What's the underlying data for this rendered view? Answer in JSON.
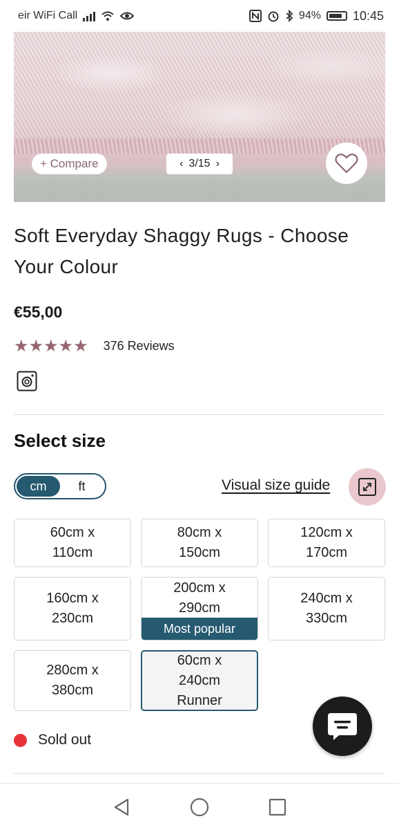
{
  "status_bar": {
    "carrier": "eir WiFi Call",
    "battery": "94%",
    "time": "10:45",
    "icons": [
      "signal-icon",
      "wifi-icon",
      "eye-icon",
      "nfc-icon",
      "alarm-icon",
      "bluetooth-icon",
      "battery-icon"
    ]
  },
  "gallery": {
    "compare_label": "+ Compare",
    "counter": "3/15",
    "prev_icon": "chevron-left-icon",
    "next_icon": "chevron-right-icon",
    "wishlist_icon": "heart-icon"
  },
  "product": {
    "title": "Soft Everyday Shaggy Rugs - Choose Your Colour",
    "price": "€55,00",
    "rating_stars": "★★★★★",
    "rating_value": 5,
    "reviews": "376 Reviews",
    "share_icon": "instagram-icon"
  },
  "size_selector": {
    "heading": "Select size",
    "units": [
      "cm",
      "ft"
    ],
    "active_unit": "cm",
    "guide_link": "Visual size guide",
    "guide_icon": "expand-icon",
    "options": [
      {
        "line1": "60cm x",
        "line2": "110cm",
        "line3": ""
      },
      {
        "line1": "80cm x",
        "line2": "150cm",
        "line3": ""
      },
      {
        "line1": "120cm x",
        "line2": "170cm",
        "line3": ""
      },
      {
        "line1": "160cm x",
        "line2": "230cm",
        "line3": ""
      },
      {
        "line1": "200cm x",
        "line2": "290cm",
        "line3": "",
        "badge": "Most popular"
      },
      {
        "line1": "240cm x",
        "line2": "330cm",
        "line3": ""
      },
      {
        "line1": "280cm x",
        "line2": "380cm",
        "line3": ""
      },
      {
        "line1": "60cm x",
        "line2": "240cm",
        "line3": "Runner",
        "selected": true
      }
    ]
  },
  "stock": {
    "status": "Sold out",
    "color": "#e8323a"
  },
  "chat": {
    "icon": "chat-icon"
  },
  "nav_bar": {
    "icons": [
      "back-icon",
      "home-icon",
      "recents-icon"
    ]
  },
  "colors": {
    "accent": "#255a70",
    "stars": "#96666f",
    "compare_text": "#8a6870",
    "expand_bg": "#e8c8cd"
  }
}
